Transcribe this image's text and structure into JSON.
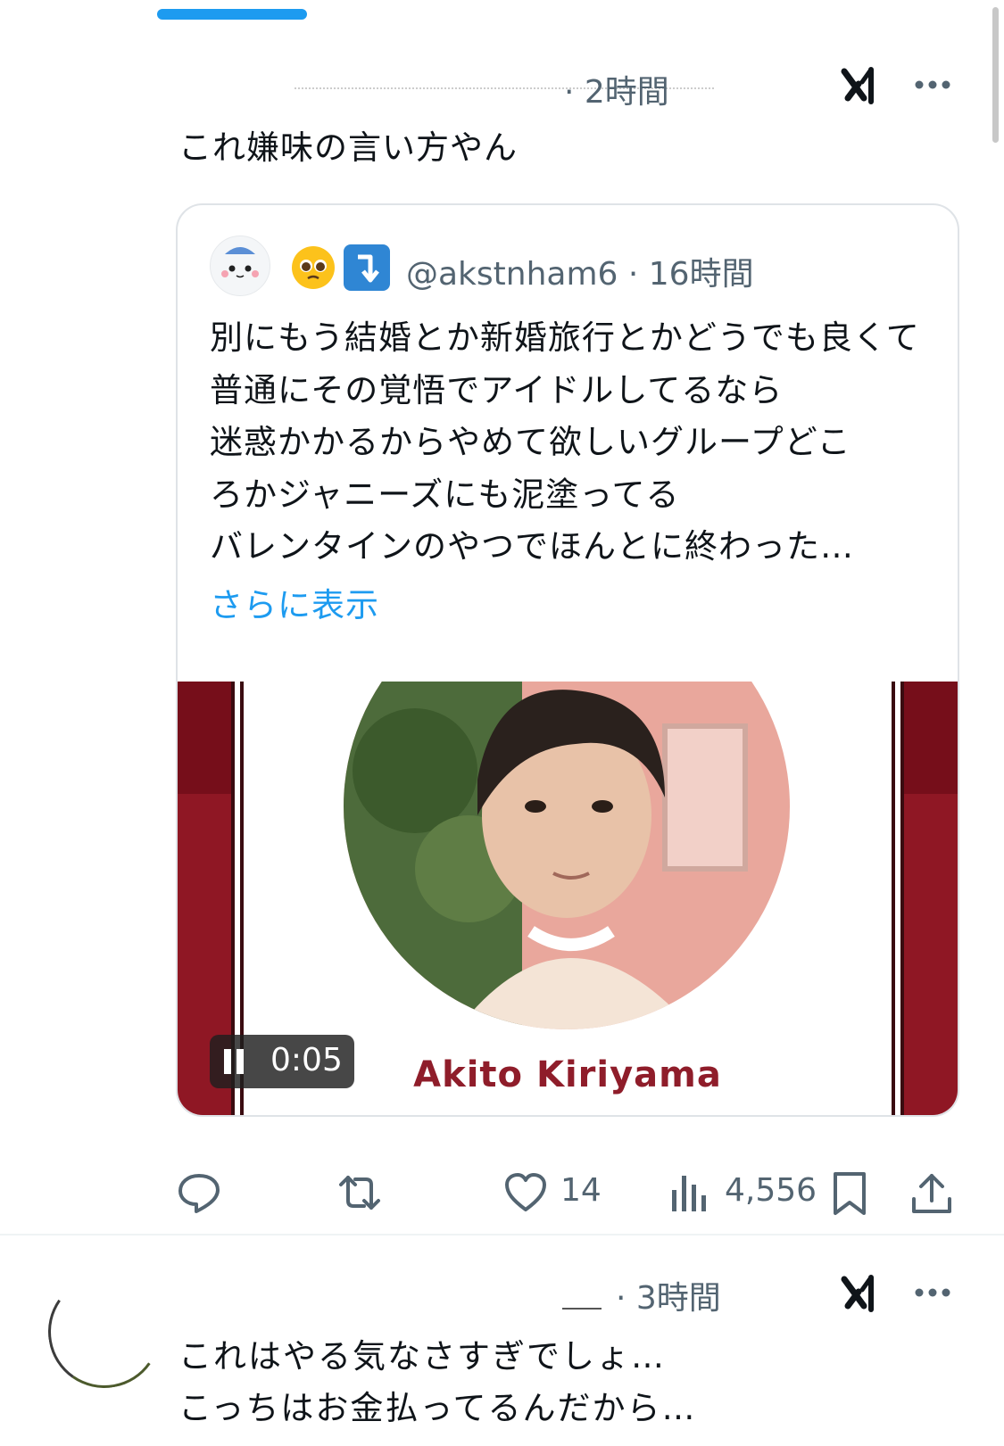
{
  "tweet1": {
    "time": "· 2時間",
    "text": "これ嫌味の言い方やん",
    "quote": {
      "handle": "@akstnham6 · 16時間",
      "text": "別にもう結婚とか新婚旅行とかどうでも良くて普通にその覚悟でアイドルしてるなら\n迷惑かかるからやめて欲しいグループどこ\nろかジャニーズにも泥塗ってる\nバレンタインのやつでほんとに終わった…",
      "show_more": "さらに表示",
      "media": {
        "name_text": "Akito Kiriyama",
        "video_time": "0:05"
      }
    },
    "actions": {
      "likes": "14",
      "views": "4,556"
    }
  },
  "tweet2": {
    "time": "· 3時間",
    "text": "これはやる気なさすぎでしょ…\nこっちはお金払ってるんだから…"
  },
  "colors": {
    "accent": "#1d9bf0",
    "secondary_text": "#536471",
    "media_maroon": "#8f1724"
  },
  "icons": [
    "grok-icon",
    "more-icon",
    "reply-icon",
    "retweet-icon",
    "like-icon",
    "views-icon",
    "bookmark-icon",
    "share-icon",
    "pause-icon"
  ]
}
